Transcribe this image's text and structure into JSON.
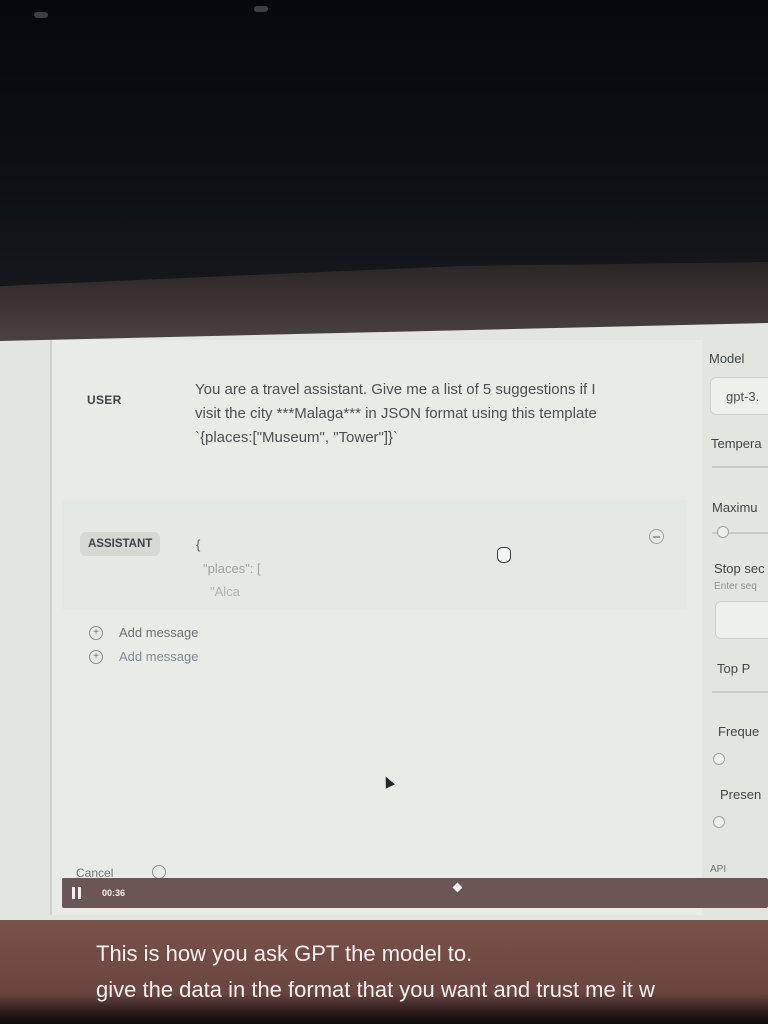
{
  "chat": {
    "user_role": "USER",
    "user_message": "You are a travel assistant. Give me a list of 5 suggestions if I visit the city ***Malaga*** in JSON format using this template `{places:[\"Museum\", \"Tower\"]}`",
    "assistant_role": "ASSISTANT",
    "assistant_lines": [
      "{",
      "\"places\": [",
      "\"Alca"
    ],
    "add_message_1": "Add message",
    "add_message_2": "Add message"
  },
  "sidebar": {
    "model_label": "Model",
    "model_value": "gpt-3.",
    "temperature_label": "Tempera",
    "max_length_label": "Maximu",
    "stop_sequences_label": "Stop sec",
    "stop_sequences_hint": "Enter seq",
    "top_p_label": "Top P",
    "frequency_label": "Freque",
    "presence_label": "Presen",
    "api_label": "API"
  },
  "footer": {
    "cancel_label": "Cancel"
  },
  "video": {
    "timecode": "00:36",
    "caption_line_1": "This is how you ask GPT the model to.",
    "caption_line_2": "give the data in the format that you want and trust me it w"
  },
  "icons": [
    "minus-circle-icon",
    "plus-circle-icon",
    "history-icon",
    "pause-icon",
    "cursor-icon",
    "hand-cursor-icon"
  ]
}
